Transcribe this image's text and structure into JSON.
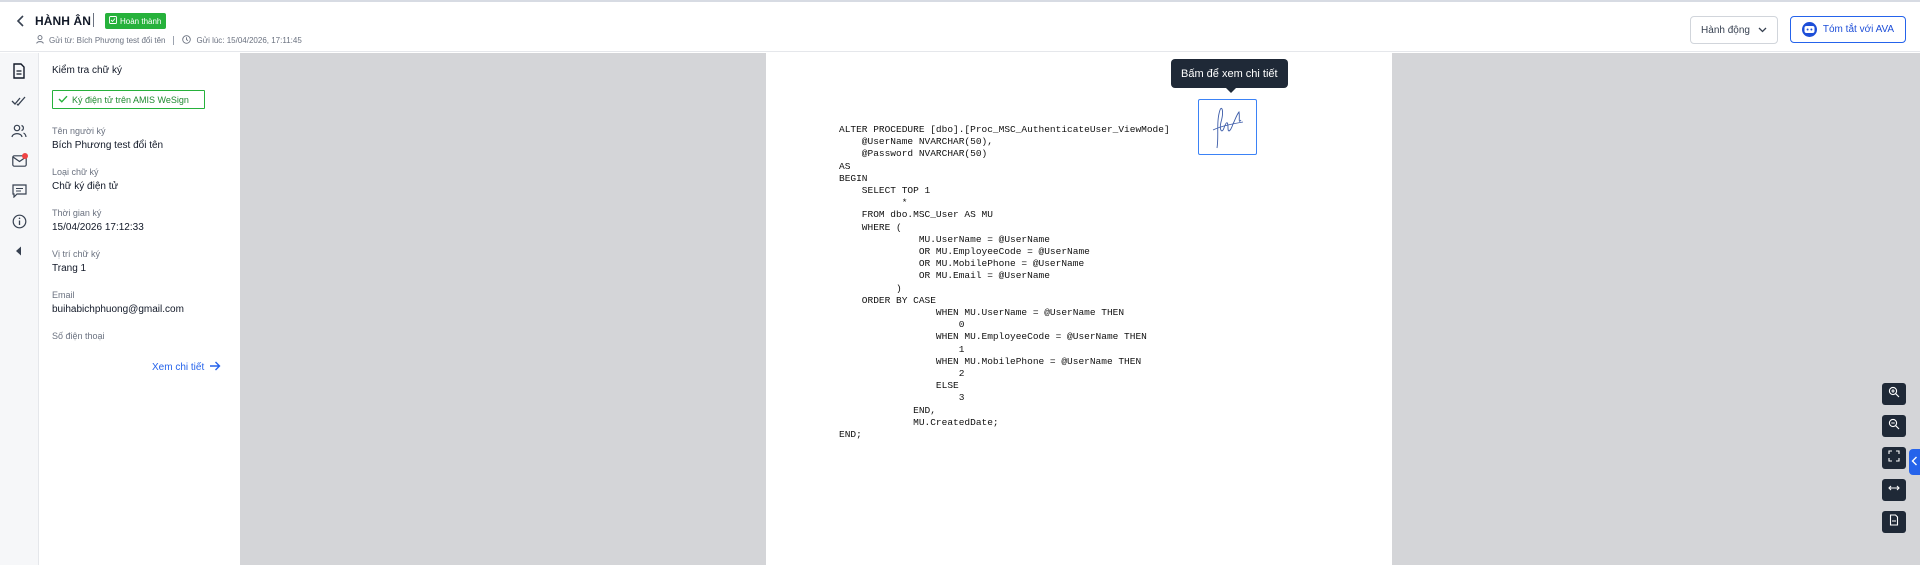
{
  "header": {
    "title": "HÀNH ÂN",
    "status": "Hoàn thành",
    "sender": "Gửi từ: Bích Phương test đổi tên",
    "sent_at": "Gửi lúc: 15/04/2026, 17:11:45",
    "actions_label": "Hành động",
    "ava_label": "Tóm tắt với AVA"
  },
  "panel": {
    "title": "Kiểm tra chữ ký",
    "signature_source": "Ký điện tử trên AMIS WeSign",
    "fields": [
      {
        "label": "Tên người ký",
        "value": "Bích Phương test đổi tên"
      },
      {
        "label": "Loại chữ ký",
        "value": "Chữ ký điện tử"
      },
      {
        "label": "Thời gian ký",
        "value": "15/04/2026 17:12:33"
      },
      {
        "label": "Vị trí chữ ký",
        "value": "Trang 1"
      },
      {
        "label": "Email",
        "value": "buihabichphuong@gmail.com"
      },
      {
        "label": "Số điện thoại",
        "value": ""
      }
    ],
    "detail_link": "Xem chi tiết"
  },
  "viewer": {
    "tooltip": "Bấm để xem chi tiết",
    "code": "ALTER PROCEDURE [dbo].[Proc_MSC_AuthenticateUser_ViewMode]\n    @UserName NVARCHAR(50),\n    @Password NVARCHAR(50)\nAS\nBEGIN\n    SELECT TOP 1\n           *\n    FROM dbo.MSC_User AS MU\n    WHERE (\n              MU.UserName = @UserName\n              OR MU.EmployeeCode = @UserName\n              OR MU.MobilePhone = @UserName\n              OR MU.Email = @UserName\n          )\n    ORDER BY CASE\n                 WHEN MU.UserName = @UserName THEN\n                     0\n                 WHEN MU.EmployeeCode = @UserName THEN\n                     1\n                 WHEN MU.MobilePhone = @UserName THEN\n                     2\n                 ELSE\n                     3\n             END,\n             MU.CreatedDate;\nEND;"
  },
  "colors": {
    "brand": "#2563eb",
    "success": "#26b13b",
    "viewer_bg": "#d4d5d8",
    "notification": "#ef4444"
  }
}
